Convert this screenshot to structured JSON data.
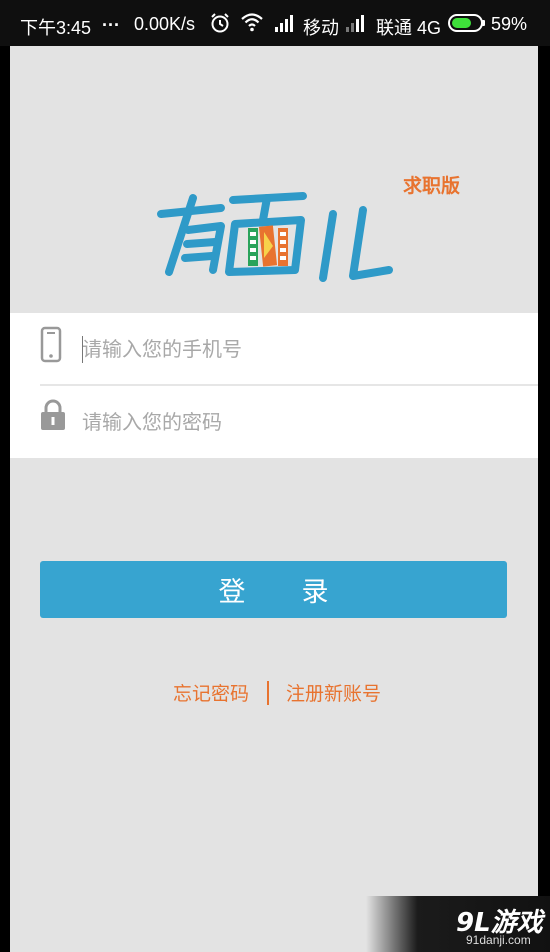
{
  "status_bar": {
    "time": "下午3:45",
    "more": "...",
    "net_speed": "0.00K/s",
    "carrier1": "移动",
    "carrier2": "联通 4G",
    "battery": "59%"
  },
  "app": {
    "logo_text": "有面儿",
    "edition": "求职版"
  },
  "login_form": {
    "phone_placeholder": "请输入您的手机号",
    "password_placeholder": "请输入您的密码",
    "login_label": "登录"
  },
  "links": {
    "forgot_password": "忘记密码",
    "register": "注册新账号"
  },
  "watermark": {
    "logo": "9L游戏",
    "url": "91danji.com"
  },
  "colors": {
    "accent_blue": "#37a4d0",
    "accent_orange": "#e8732f",
    "logo_blue": "#2f9ac8",
    "background": "#e3e3e3"
  },
  "icons": [
    "alarm-icon",
    "wifi-icon",
    "signal-icon",
    "battery-icon",
    "phone-icon",
    "lock-icon"
  ]
}
